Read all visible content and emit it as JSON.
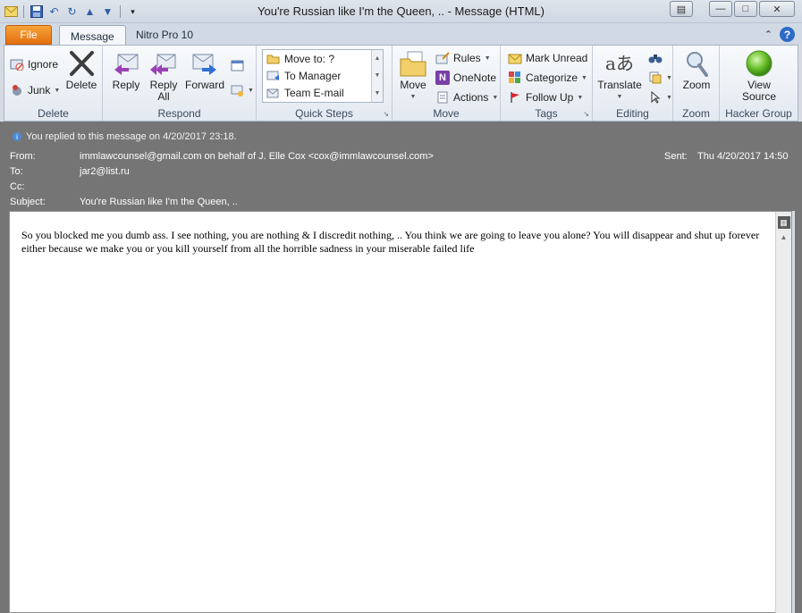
{
  "window": {
    "title": "You're Russian like I'm the Queen, ..  -  Message (HTML)"
  },
  "tabs": {
    "file": "File",
    "message": "Message",
    "nitro": "Nitro Pro 10"
  },
  "ribbon": {
    "delete_group": {
      "ignore": "Ignore",
      "junk": "Junk",
      "delete": "Delete",
      "label": "Delete"
    },
    "respond_group": {
      "reply": "Reply",
      "reply_all_1": "Reply",
      "reply_all_2": "All",
      "forward": "Forward",
      "label": "Respond"
    },
    "quick_steps": {
      "items": [
        "Move to: ?",
        "To Manager",
        "Team E-mail"
      ],
      "label": "Quick Steps"
    },
    "move_group": {
      "move": "Move",
      "rules": "Rules",
      "onenote": "OneNote",
      "actions": "Actions",
      "label": "Move"
    },
    "tags_group": {
      "mark_unread": "Mark Unread",
      "categorize": "Categorize",
      "follow_up": "Follow Up",
      "label": "Tags"
    },
    "editing_group": {
      "translate": "Translate",
      "label": "Editing"
    },
    "zoom_group": {
      "zoom": "Zoom",
      "label": "Zoom"
    },
    "hacker_group": {
      "view_source_1": "View",
      "view_source_2": "Source",
      "label": "Hacker Group"
    }
  },
  "header": {
    "info": "You replied to this message on 4/20/2017 23:18.",
    "from_label": "From:",
    "from_value": "immlawcounsel@gmail.com on behalf of J. Elle Cox <cox@immlawcounsel.com>",
    "to_label": "To:",
    "to_value": "jar2@list.ru",
    "cc_label": "Cc:",
    "subject_label": "Subject:",
    "subject_value": "You're Russian like I'm the Queen, ..",
    "sent_label": "Sent:",
    "sent_value": "Thu 4/20/2017 14:50"
  },
  "message": {
    "body": "So you blocked me you dumb ass. I see nothing, you are nothing & I discredit nothing, .. You think we are going to leave you alone? You will disappear and shut up forever either because we make you or  you kill yourself from all the horrible sadness in your miserable failed life"
  },
  "colors": {
    "file_tab": "#e46e0f",
    "header_bg": "#757575",
    "ribbon_bg": "#e3e9f1"
  }
}
